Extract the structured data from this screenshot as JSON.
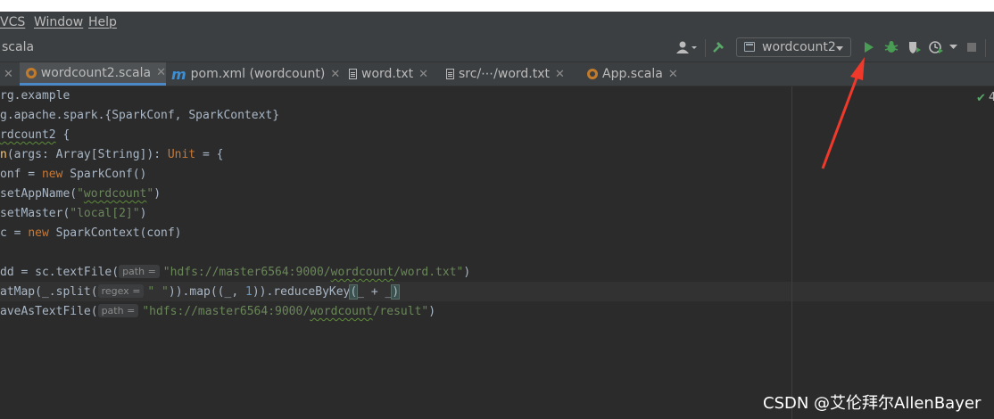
{
  "menu": {
    "items": [
      "VCS",
      "Window",
      "Help"
    ]
  },
  "breadcrumb": {
    "text": "scala"
  },
  "toolbar": {
    "run_config": "wordcount2"
  },
  "tabs": [
    {
      "label": "wordcount2.scala",
      "icon": "scala-icon",
      "active": true
    },
    {
      "label": "pom.xml (wordcount)",
      "icon": "maven-icon",
      "active": false
    },
    {
      "label": "word.txt",
      "icon": "text-file-icon",
      "active": false
    },
    {
      "label": "src/⋯/word.txt",
      "icon": "text-file-icon",
      "active": false
    },
    {
      "label": "App.scala",
      "icon": "scala-icon",
      "active": false
    }
  ],
  "editor": {
    "lines": {
      "l1": "rg.example",
      "l2": "g.apache.spark.{SparkConf, SparkContext}",
      "l3a": "rdcount2",
      "l3b": " {",
      "l4a": "n",
      "l4b": "(args: Array[String]): ",
      "l4c": "Unit",
      "l4d": " = {",
      "l5a": "onf = ",
      "l5b": "new",
      "l5c": " SparkConf()",
      "l6a": "setAppName(",
      "l6b": "\"",
      "l6c": "wordcount",
      "l6d": "\"",
      "l6e": ")",
      "l7a": "setMaster(",
      "l7b": "\"local[2]\"",
      "l7c": ")",
      "l8a": "c = ",
      "l8b": "new",
      "l8c": " SparkContext(conf)",
      "l10a": "dd = sc.textFile(",
      "l10b": "\"hdfs://master6564:9000/",
      "l10c": "wordcount",
      "l10d": "/word.txt\"",
      "l10e": ")",
      "l11a": "atMap(_.split(",
      "l11b": "\" \"",
      "l11c": ")).map((_, ",
      "l11d": "1",
      "l11e": ")).reduceByKey",
      "l11f": "(",
      "l11g": "_ + _",
      "l11h": ")",
      "l12a": "aveAsTextFile(",
      "l12b": "\"hdfs://master6564:9000/",
      "l12c": "wordcount",
      "l12d": "/result\"",
      "l12e": ")"
    },
    "hints": {
      "path": "path =",
      "regex": "regex ="
    },
    "inspection_count": "4"
  },
  "watermark": "CSDN @艾伦拜尔AllenBayer",
  "colors": {
    "run": "#499c54",
    "accent": "#4a88c7",
    "annotation_arrow": "#f0392b"
  }
}
